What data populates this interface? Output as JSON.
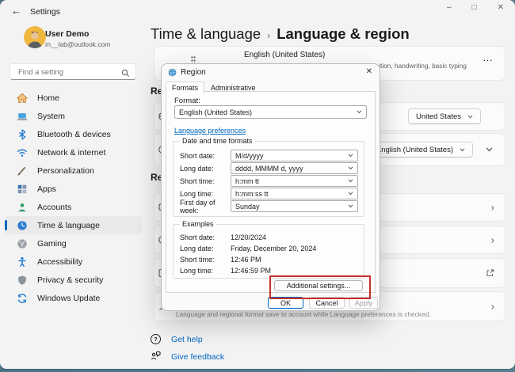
{
  "icons": {
    "back": "←",
    "minimize": "–",
    "maximize": "□",
    "close": "✕",
    "more": "…",
    "chevron_right": "›",
    "question": "?"
  },
  "colors": {
    "accent": "#0067c0",
    "highlight_red": "#c4302b"
  },
  "window": {
    "app_title": "Settings"
  },
  "sidebar": {
    "user": {
      "name": "User Demo",
      "email": "m__lab@outlook.com"
    },
    "search": {
      "placeholder": "Find a setting"
    },
    "items": [
      {
        "label": "Home"
      },
      {
        "label": "System"
      },
      {
        "label": "Bluetooth & devices"
      },
      {
        "label": "Network & internet"
      },
      {
        "label": "Personalization"
      },
      {
        "label": "Apps"
      },
      {
        "label": "Accounts"
      },
      {
        "label": "Time & language"
      },
      {
        "label": "Gaming"
      },
      {
        "label": "Accessibility"
      },
      {
        "label": "Privacy & security"
      },
      {
        "label": "Windows Update"
      }
    ]
  },
  "main": {
    "breadcrumb": {
      "parent": "Time & language",
      "separator": "›",
      "current": "Language & region"
    },
    "language_card": {
      "title": "English (United States)",
      "subtitle": "language pack, text-to-speech, speech recognition, handwriting, basic typing"
    },
    "region_heading": "Region",
    "country_value": "United States",
    "regional_format_value": "English (United States)",
    "related_heading": "Related settings",
    "account_note": "Language and regional format save to account while Language preferences is checked.",
    "links": {
      "get_help": "Get help",
      "give_feedback": "Give feedback"
    }
  },
  "dialog": {
    "title": "Region",
    "tabs": [
      {
        "label": "Formats"
      },
      {
        "label": "Administrative"
      }
    ],
    "format_label": "Format:",
    "format_value": "English (United States)",
    "language_preferences_link": "Language preferences",
    "datetime_group": {
      "heading": "Date and time formats",
      "rows": [
        {
          "label": "Short date:",
          "value": "M/d/yyyy"
        },
        {
          "label": "Long date:",
          "value": "dddd, MMMM d, yyyy"
        },
        {
          "label": "Short time:",
          "value": "h:mm tt"
        },
        {
          "label": "Long time:",
          "value": "h:mm:ss tt"
        },
        {
          "label": "First day of week:",
          "value": "Sunday"
        }
      ]
    },
    "examples_group": {
      "heading": "Examples",
      "rows": [
        {
          "label": "Short date:",
          "value": "12/20/2024"
        },
        {
          "label": "Long date:",
          "value": "Friday, December 20, 2024"
        },
        {
          "label": "Short time:",
          "value": "12:46 PM"
        },
        {
          "label": "Long time:",
          "value": "12:46:59 PM"
        }
      ]
    },
    "additional_settings_label": "Additional settings...",
    "buttons": {
      "ok": "OK",
      "cancel": "Cancel",
      "apply": "Apply"
    }
  }
}
